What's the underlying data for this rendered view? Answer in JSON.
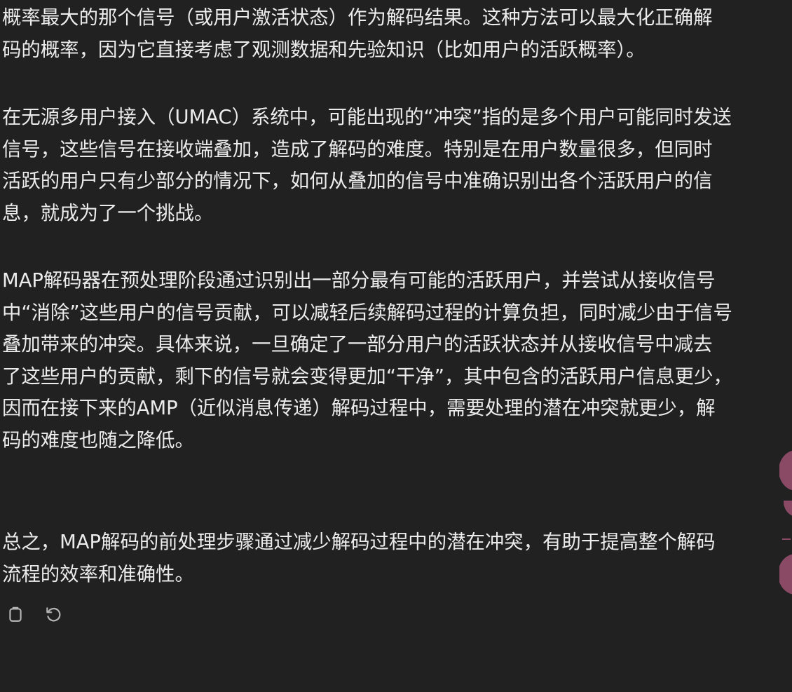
{
  "message": {
    "paragraphs": [
      {
        "lines": [
          "概率最大的那个信号（或用户激活状态）作为解码结果。这种方法可以最大化正确解",
          "码的概率，因为它直接考虑了观测数据和先验知识（比如用户的活跃概率）。"
        ]
      },
      {
        "lines": [
          "在无源多用户接入（UMAC）系统中，可能出现的“冲突”指的是多个用户可能同时发送",
          "信号，这些信号在接收端叠加，造成了解码的难度。特别是在用户数量很多，但同时",
          "活跃的用户只有少部分的情况下，如何从叠加的信号中准确识别出各个活跃用户的信",
          "息，就成为了一个挑战。"
        ]
      },
      {
        "lines": [
          "MAP解码器在预处理阶段通过识别出一部分最有可能的活跃用户，并尝试从接收信号",
          "中“消除”这些用户的信号贡献，可以减轻后续解码过程的计算负担，同时减少由于信号",
          "叠加带来的冲突。具体来说，一旦确定了一部分用户的活跃状态并从接收信号中减去",
          "了这些用户的贡献，剩下的信号就会变得更加“干净”，其中包含的活跃用户信息更少，",
          "因而在接下来的AMP（近似消息传递）解码过程中，需要处理的潜在冲突就更少，解",
          "码的难度也随之降低。"
        ]
      },
      {
        "lines": [
          "总之，MAP解码的前处理步骤通过减少解码过程中的潜在冲突，有助于提高整个解码",
          "流程的效率和准确性。"
        ]
      }
    ]
  },
  "actions": {
    "copy_icon": "clipboard-icon",
    "regenerate_icon": "regenerate-icon"
  },
  "colors": {
    "background": "#212121",
    "text": "#ececec",
    "icon": "#b4b4b4",
    "edge_accent": "#8a4a65"
  }
}
